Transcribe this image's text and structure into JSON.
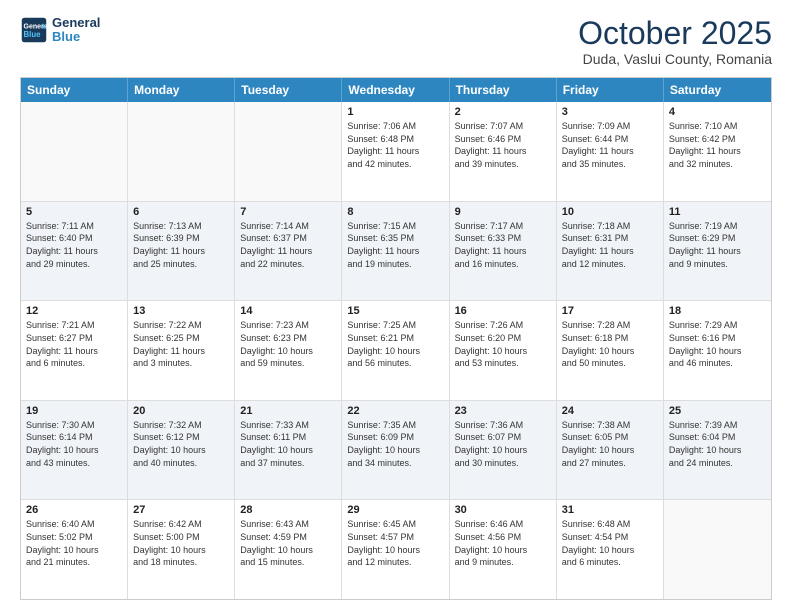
{
  "header": {
    "logo_line1": "General",
    "logo_line2": "Blue",
    "title": "October 2025",
    "subtitle": "Duda, Vaslui County, Romania"
  },
  "days_of_week": [
    "Sunday",
    "Monday",
    "Tuesday",
    "Wednesday",
    "Thursday",
    "Friday",
    "Saturday"
  ],
  "weeks": [
    {
      "shaded": false,
      "cells": [
        {
          "day": "",
          "info": ""
        },
        {
          "day": "",
          "info": ""
        },
        {
          "day": "",
          "info": ""
        },
        {
          "day": "1",
          "info": "Sunrise: 7:06 AM\nSunset: 6:48 PM\nDaylight: 11 hours\nand 42 minutes."
        },
        {
          "day": "2",
          "info": "Sunrise: 7:07 AM\nSunset: 6:46 PM\nDaylight: 11 hours\nand 39 minutes."
        },
        {
          "day": "3",
          "info": "Sunrise: 7:09 AM\nSunset: 6:44 PM\nDaylight: 11 hours\nand 35 minutes."
        },
        {
          "day": "4",
          "info": "Sunrise: 7:10 AM\nSunset: 6:42 PM\nDaylight: 11 hours\nand 32 minutes."
        }
      ]
    },
    {
      "shaded": true,
      "cells": [
        {
          "day": "5",
          "info": "Sunrise: 7:11 AM\nSunset: 6:40 PM\nDaylight: 11 hours\nand 29 minutes."
        },
        {
          "day": "6",
          "info": "Sunrise: 7:13 AM\nSunset: 6:39 PM\nDaylight: 11 hours\nand 25 minutes."
        },
        {
          "day": "7",
          "info": "Sunrise: 7:14 AM\nSunset: 6:37 PM\nDaylight: 11 hours\nand 22 minutes."
        },
        {
          "day": "8",
          "info": "Sunrise: 7:15 AM\nSunset: 6:35 PM\nDaylight: 11 hours\nand 19 minutes."
        },
        {
          "day": "9",
          "info": "Sunrise: 7:17 AM\nSunset: 6:33 PM\nDaylight: 11 hours\nand 16 minutes."
        },
        {
          "day": "10",
          "info": "Sunrise: 7:18 AM\nSunset: 6:31 PM\nDaylight: 11 hours\nand 12 minutes."
        },
        {
          "day": "11",
          "info": "Sunrise: 7:19 AM\nSunset: 6:29 PM\nDaylight: 11 hours\nand 9 minutes."
        }
      ]
    },
    {
      "shaded": false,
      "cells": [
        {
          "day": "12",
          "info": "Sunrise: 7:21 AM\nSunset: 6:27 PM\nDaylight: 11 hours\nand 6 minutes."
        },
        {
          "day": "13",
          "info": "Sunrise: 7:22 AM\nSunset: 6:25 PM\nDaylight: 11 hours\nand 3 minutes."
        },
        {
          "day": "14",
          "info": "Sunrise: 7:23 AM\nSunset: 6:23 PM\nDaylight: 10 hours\nand 59 minutes."
        },
        {
          "day": "15",
          "info": "Sunrise: 7:25 AM\nSunset: 6:21 PM\nDaylight: 10 hours\nand 56 minutes."
        },
        {
          "day": "16",
          "info": "Sunrise: 7:26 AM\nSunset: 6:20 PM\nDaylight: 10 hours\nand 53 minutes."
        },
        {
          "day": "17",
          "info": "Sunrise: 7:28 AM\nSunset: 6:18 PM\nDaylight: 10 hours\nand 50 minutes."
        },
        {
          "day": "18",
          "info": "Sunrise: 7:29 AM\nSunset: 6:16 PM\nDaylight: 10 hours\nand 46 minutes."
        }
      ]
    },
    {
      "shaded": true,
      "cells": [
        {
          "day": "19",
          "info": "Sunrise: 7:30 AM\nSunset: 6:14 PM\nDaylight: 10 hours\nand 43 minutes."
        },
        {
          "day": "20",
          "info": "Sunrise: 7:32 AM\nSunset: 6:12 PM\nDaylight: 10 hours\nand 40 minutes."
        },
        {
          "day": "21",
          "info": "Sunrise: 7:33 AM\nSunset: 6:11 PM\nDaylight: 10 hours\nand 37 minutes."
        },
        {
          "day": "22",
          "info": "Sunrise: 7:35 AM\nSunset: 6:09 PM\nDaylight: 10 hours\nand 34 minutes."
        },
        {
          "day": "23",
          "info": "Sunrise: 7:36 AM\nSunset: 6:07 PM\nDaylight: 10 hours\nand 30 minutes."
        },
        {
          "day": "24",
          "info": "Sunrise: 7:38 AM\nSunset: 6:05 PM\nDaylight: 10 hours\nand 27 minutes."
        },
        {
          "day": "25",
          "info": "Sunrise: 7:39 AM\nSunset: 6:04 PM\nDaylight: 10 hours\nand 24 minutes."
        }
      ]
    },
    {
      "shaded": false,
      "cells": [
        {
          "day": "26",
          "info": "Sunrise: 6:40 AM\nSunset: 5:02 PM\nDaylight: 10 hours\nand 21 minutes."
        },
        {
          "day": "27",
          "info": "Sunrise: 6:42 AM\nSunset: 5:00 PM\nDaylight: 10 hours\nand 18 minutes."
        },
        {
          "day": "28",
          "info": "Sunrise: 6:43 AM\nSunset: 4:59 PM\nDaylight: 10 hours\nand 15 minutes."
        },
        {
          "day": "29",
          "info": "Sunrise: 6:45 AM\nSunset: 4:57 PM\nDaylight: 10 hours\nand 12 minutes."
        },
        {
          "day": "30",
          "info": "Sunrise: 6:46 AM\nSunset: 4:56 PM\nDaylight: 10 hours\nand 9 minutes."
        },
        {
          "day": "31",
          "info": "Sunrise: 6:48 AM\nSunset: 4:54 PM\nDaylight: 10 hours\nand 6 minutes."
        },
        {
          "day": "",
          "info": ""
        }
      ]
    }
  ]
}
